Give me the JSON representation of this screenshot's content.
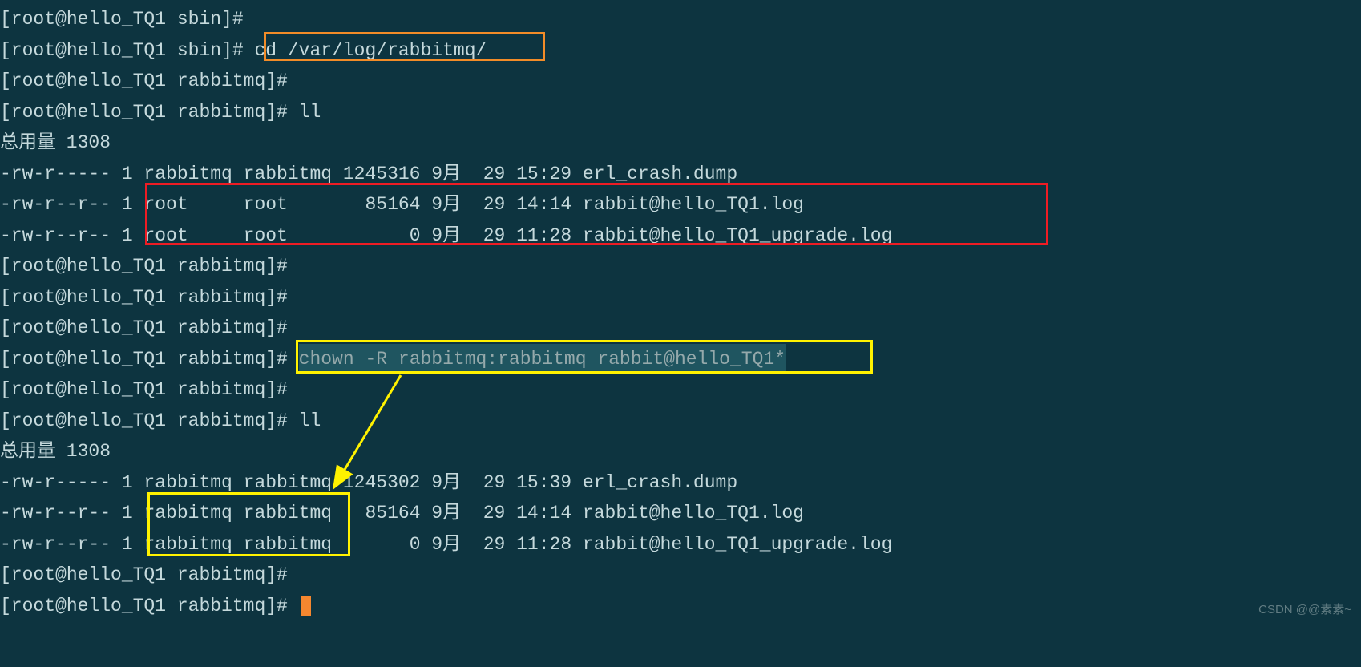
{
  "lines": {
    "l1_prompt": "[root@hello_TQ1 sbin]#",
    "l2_prompt": "[root@hello_TQ1 sbin]# ",
    "l2_cmd": "cd /var/log/rabbitmq/",
    "l3_prompt": "[root@hello_TQ1 rabbitmq]#",
    "l4_prompt": "[root@hello_TQ1 rabbitmq]# ",
    "l4_cmd": "ll",
    "l5_total": "总用量 1308",
    "l6": "-rw-r----- 1 rabbitmq rabbitmq 1245316 9月  29 15:29 erl_crash.dump",
    "l7_pre": "-rw-r--r-- 1 ",
    "l7_mid": "root     root       85164 9月  29 14:14 rabbit@hello_TQ1.log",
    "l8_pre": "-rw-r--r-- 1 ",
    "l8_mid": "root     root           0 9月  29 11:28 rabbit@hello_TQ1_upgrade.log",
    "l9_prompt": "[root@hello_TQ1 rabbitmq]#",
    "l10_prompt": "[root@hello_TQ1 rabbitmq]#",
    "l11_prompt": "[root@hello_TQ1 rabbitmq]#",
    "l12_prompt": "[root@hello_TQ1 rabbitmq]# ",
    "l12_cmd": "chown -R rabbitmq:rabbitmq rabbit@hello_TQ1*",
    "l13_prompt": "[root@hello_TQ1 rabbitmq]#",
    "l14_prompt": "[root@hello_TQ1 rabbitmq]# ",
    "l14_cmd": "ll",
    "l15_total": "总用量 1308",
    "l16": "-rw-r----- 1 rabbitmq rabbitmq 1245302 9月  29 15:39 erl_crash.dump",
    "l17_pre": "-rw-r--r-- 1 ",
    "l17_mid": "rabbitmq rabbitmq",
    "l17_post": "   85164 9月  29 14:14 rabbit@hello_TQ1.log",
    "l18_pre": "-rw-r--r-- 1 ",
    "l18_mid": "rabbitmq rabbitmq",
    "l18_post": "       0 9月  29 11:28 rabbit@hello_TQ1_upgrade.log",
    "l19_prompt": "[root@hello_TQ1 rabbitmq]#",
    "l20_prompt": "[root@hello_TQ1 rabbitmq]# "
  },
  "annotations": {
    "orange_box_label": "cd-command-highlight",
    "red_box_label": "root-owned-files-highlight",
    "yellow_box1_label": "chown-command-highlight",
    "yellow_box2_label": "rabbitmq-owner-highlight",
    "arrow_label": "chown-result-arrow"
  },
  "watermark": "CSDN @@素素~"
}
